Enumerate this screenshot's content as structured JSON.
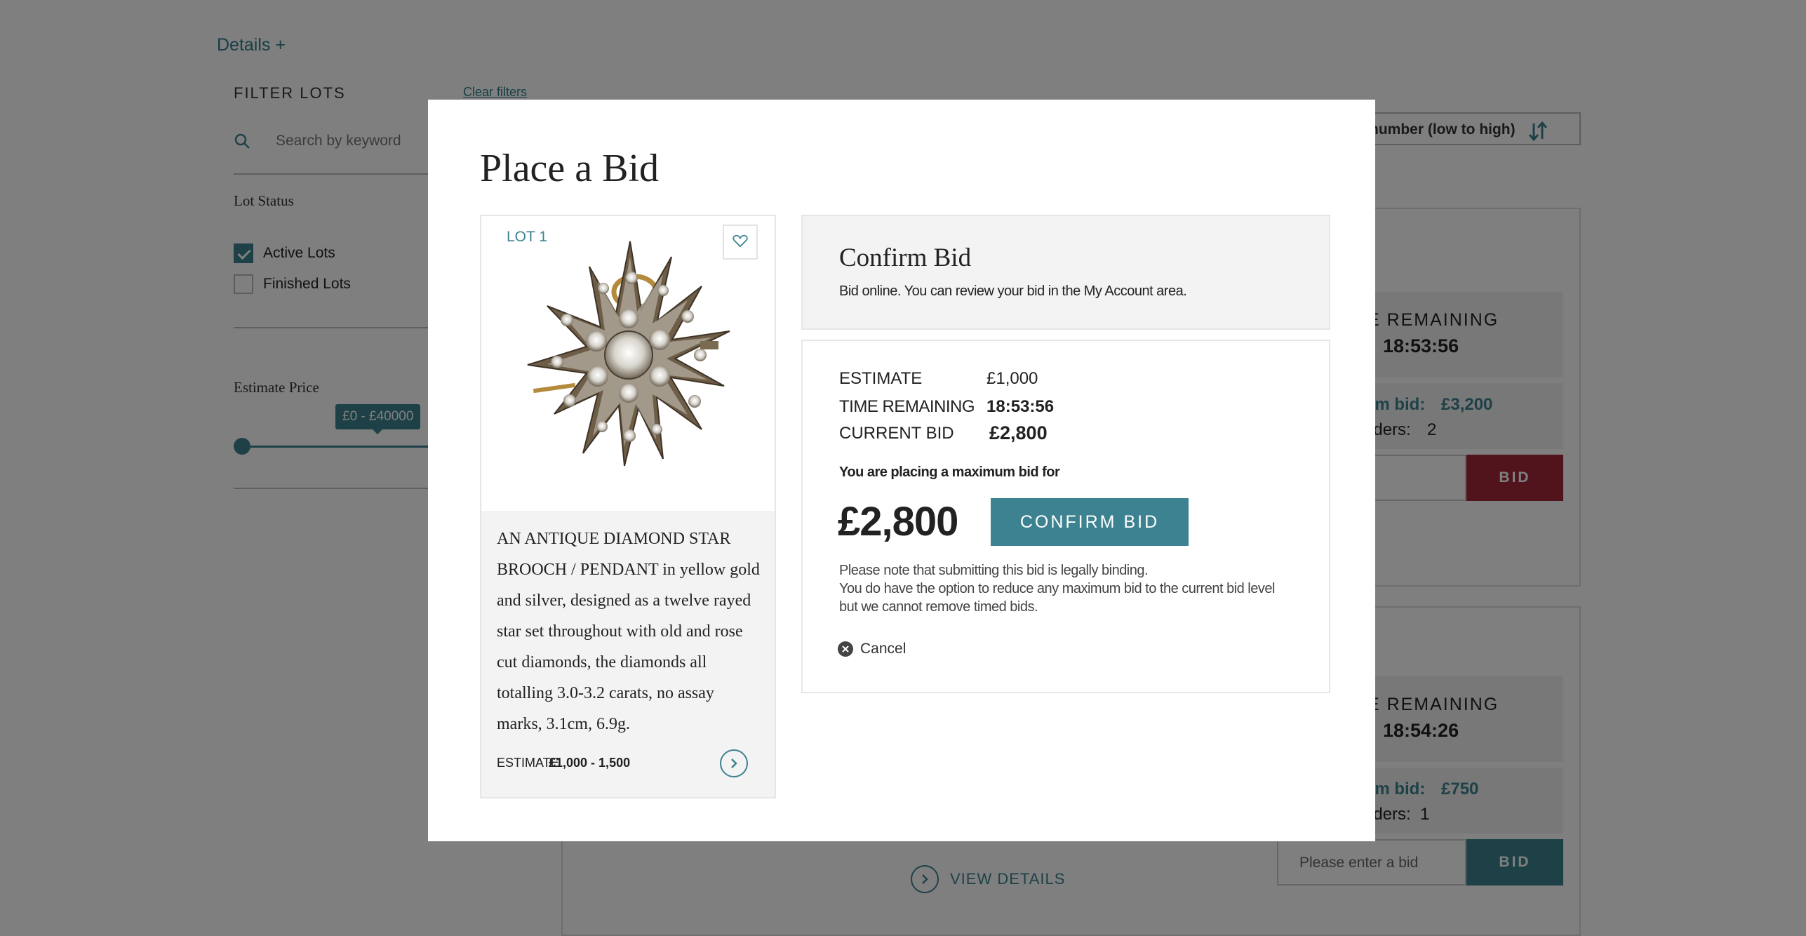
{
  "background": {
    "details_link": "Details +",
    "filter_title": "FILTER LOTS",
    "clear_filters": "Clear filters",
    "search_placeholder": "Search by keyword",
    "lot_status_heading": "Lot Status",
    "active_lots": "Active Lots",
    "finished_lots": "Finished Lots",
    "estimate_price_heading": "Estimate Price",
    "price_range_badge": "£0 - £40000",
    "sort_label": "number (low to high)",
    "card1": {
      "time_label": "IE REMAINING",
      "time_value": "18:53:56",
      "max_bid_label": "num bid:",
      "max_bid_value": "£3,200",
      "bidders_label": "dders:",
      "bidders_value": "2",
      "bid_button": "BID"
    },
    "card2": {
      "time_label": "IE REMAINING",
      "time_value": "18:54:26",
      "max_bid_label": "num bid:",
      "max_bid_value": "£750",
      "bidders_label": "dders:",
      "bidders_value": "1",
      "bid_placeholder": "Please enter a bid",
      "bid_button": "BID",
      "view_details": "VIEW DETAILS"
    }
  },
  "modal": {
    "title": "Place a Bid",
    "lot": {
      "lot_number": "LOT 1",
      "description_caps": "AN ANTIQUE DIAMOND STAR BROOCH / PENDANT",
      "description_rest": " in yellow gold and silver, designed as a twelve rayed star set throughout with old and rose cut diamonds, the diamonds all totalling 3.0-3.2 carats, no assay marks, 3.1cm, 6.9g.",
      "estimate_label": "ESTIMATE",
      "estimate_value": "£1,000 - 1,500",
      "image_icon": "star-brooch-image",
      "favourite_icon": "heart-icon"
    },
    "confirm": {
      "heading": "Confirm Bid",
      "subtext": "Bid online. You can review your bid in the My Account area."
    },
    "details": {
      "estimate_label": "ESTIMATE",
      "estimate_value": "£1,000",
      "time_label": "TIME REMAINING",
      "time_value": "18:53:56",
      "current_label": "CURRENT BID",
      "current_value": "£2,800",
      "max_bid_text": "You are placing a maximum bid for",
      "max_bid_amount": "£2,800",
      "confirm_button": "CONFIRM BID",
      "note_line1": "Please note that submitting this bid is legally binding.",
      "note_line2": "You do have the option to reduce any maximum bid to the current bid level",
      "note_line3": "but we cannot remove timed bids.",
      "cancel": "Cancel"
    }
  },
  "colors": {
    "accent": "#3d8290",
    "bid_red": "#a3293a",
    "overlay": "rgba(0,0,0,0.5)"
  }
}
